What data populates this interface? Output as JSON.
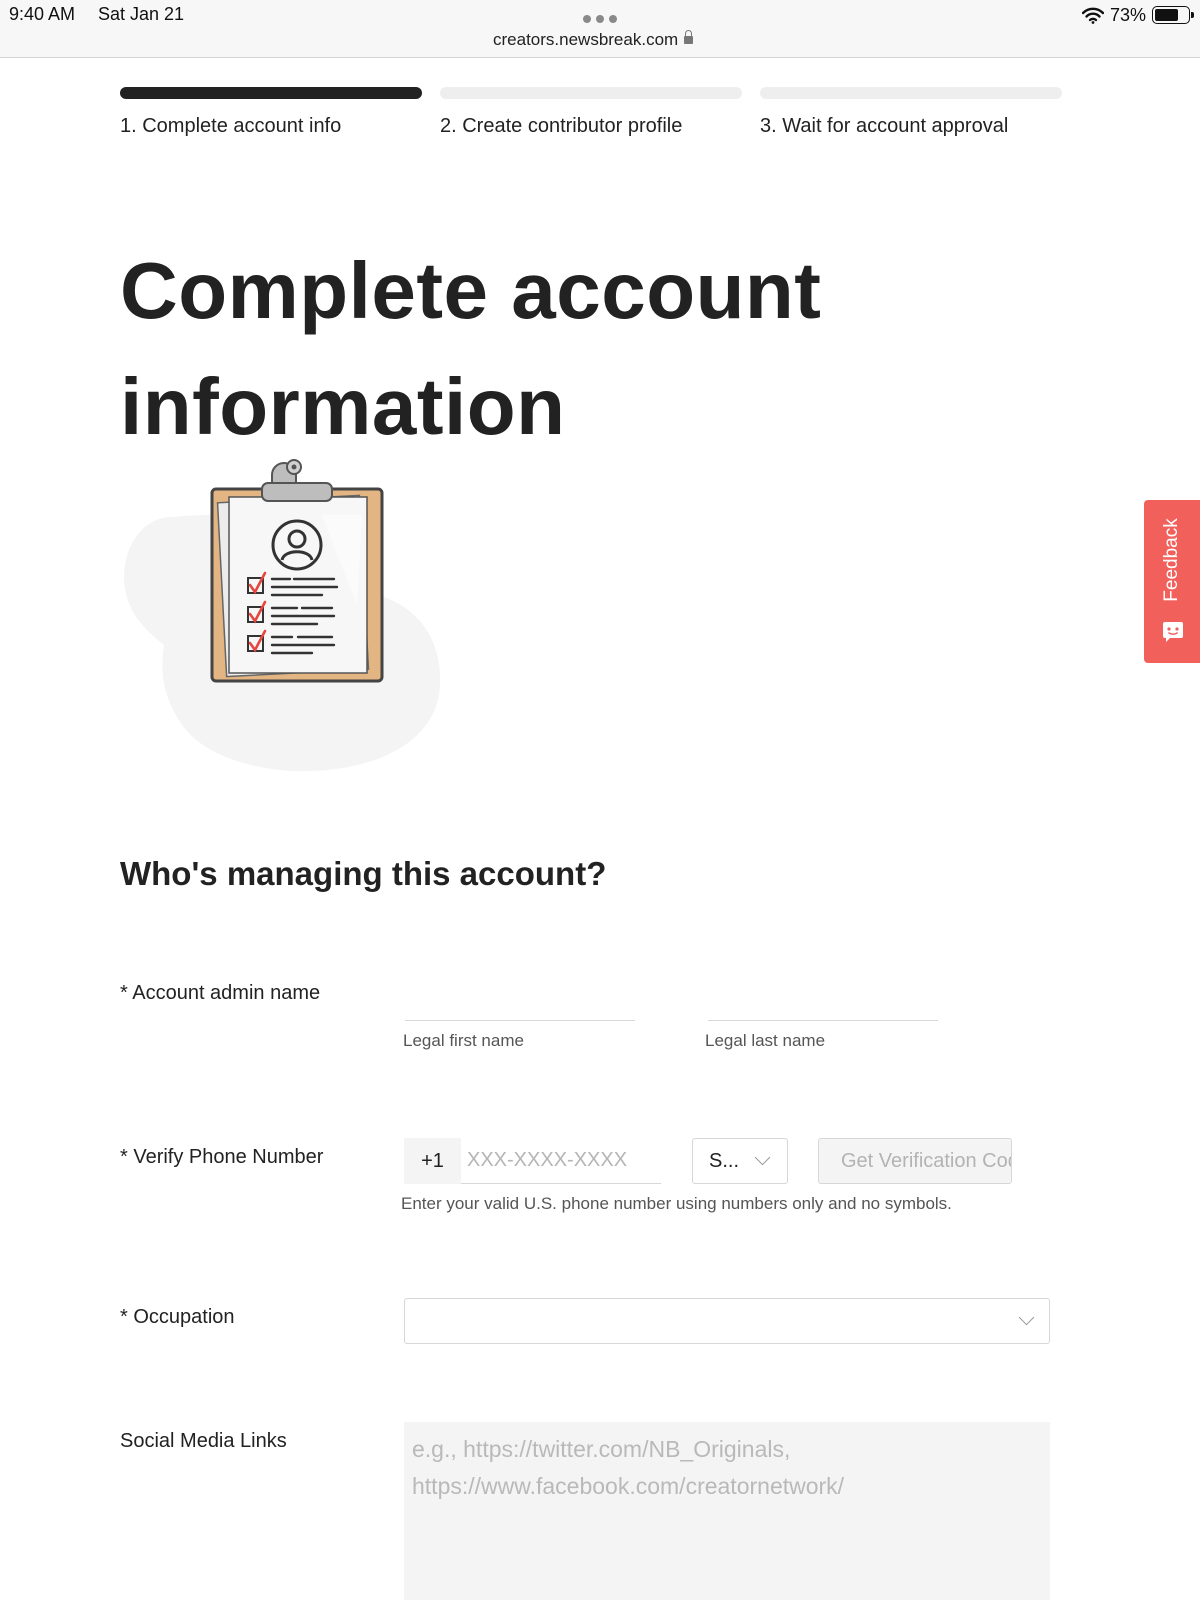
{
  "status_bar": {
    "time": "9:40 AM",
    "date": "Sat Jan 21",
    "url": "creators.newsbreak.com",
    "battery": "73%",
    "battery_level": 0.73,
    "icons": [
      "wifi-icon",
      "battery-icon",
      "lock-icon",
      "more-dots-icon"
    ]
  },
  "steps": [
    {
      "label": "1. Complete account info",
      "active": true
    },
    {
      "label": "2. Create contributor profile",
      "active": false
    },
    {
      "label": "3. Wait for account approval",
      "active": false
    }
  ],
  "page": {
    "title": "Complete account information",
    "illustration_icon": "clipboard-checklist-icon"
  },
  "form": {
    "section_heading": "Who's managing this account?",
    "admin_name": {
      "label": "* Account admin name",
      "first_name_label": "Legal first name",
      "first_name_value": "",
      "last_name_label": "Legal last name",
      "last_name_value": ""
    },
    "phone": {
      "label": "* Verify Phone Number",
      "country_code": "+1",
      "value": "",
      "placeholder": "XXX-XXXX-XXXX",
      "method_select": "S...",
      "verify_button": "Get Verification Code",
      "help": "Enter your valid U.S. phone number using numbers only and no symbols."
    },
    "occupation": {
      "label": "* Occupation",
      "value": ""
    },
    "social": {
      "label": "Social Media Links",
      "value": "",
      "placeholder": "e.g., https://twitter.com/NB_Originals,\nhttps://www.facebook.com/creatornetwork/"
    }
  },
  "feedback": {
    "label": "Feedback",
    "color": "#f1605a",
    "icon": "feedback-face-icon"
  },
  "colors": {
    "active_step": "#222222",
    "inactive_step": "#eeeeee",
    "text": "#222222",
    "border": "#d7d7d7"
  }
}
